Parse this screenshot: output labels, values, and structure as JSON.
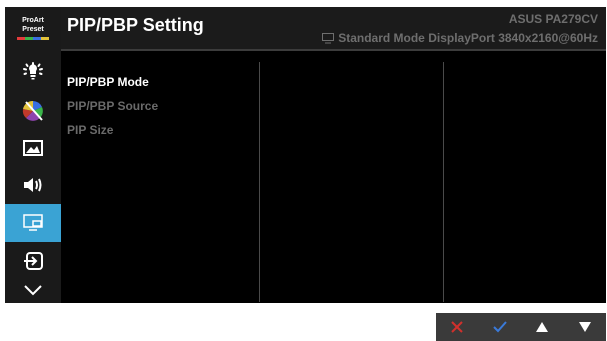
{
  "sidebar": {
    "preset": {
      "line1": "ProArt",
      "line2": "Preset",
      "colors": [
        "#e23b3b",
        "#3ab54a",
        "#3a6fe2",
        "#e2c23a"
      ]
    },
    "items": [
      {
        "icon": "brightness-icon"
      },
      {
        "icon": "color-icon"
      },
      {
        "icon": "image-icon"
      },
      {
        "icon": "sound-icon"
      },
      {
        "icon": "pip-pbp-icon",
        "active": true
      },
      {
        "icon": "input-select-icon"
      },
      {
        "icon": "chevron-down-icon"
      }
    ]
  },
  "header": {
    "title": "PIP/PBP Setting",
    "model": "ASUS PA279CV",
    "status": "Standard Mode DisplayPort 3840x2160@60Hz",
    "status_icon": "monitor-icon"
  },
  "menu": {
    "items": [
      {
        "label": "PIP/PBP Mode",
        "active": true
      },
      {
        "label": "PIP/PBP Source",
        "active": false
      },
      {
        "label": "PIP Size",
        "active": false
      }
    ]
  },
  "keys": [
    {
      "icon": "close-icon",
      "color": "#d0302c"
    },
    {
      "icon": "check-icon",
      "color": "#3a7ad9"
    },
    {
      "icon": "up-arrow-icon",
      "color": "#ffffff"
    },
    {
      "icon": "down-arrow-icon",
      "color": "#ffffff"
    }
  ],
  "colors": {
    "accent": "#3aa3d4",
    "osd_background": "#000000",
    "inactive_text": "#6a6a6a"
  }
}
